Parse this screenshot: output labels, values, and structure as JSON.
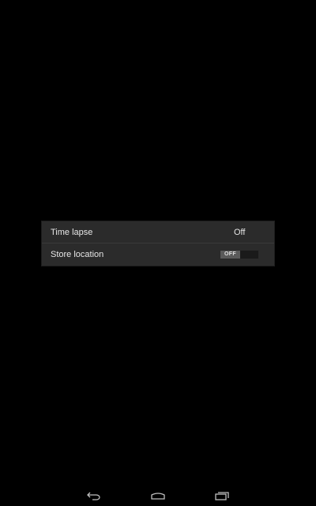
{
  "settings": {
    "rows": [
      {
        "label": "Time lapse",
        "value": "Off"
      },
      {
        "label": "Store location",
        "toggle_text": "OFF",
        "toggle_state": "off"
      }
    ]
  },
  "navigation": {
    "back_icon": "back-icon",
    "home_icon": "home-icon",
    "recents_icon": "recents-icon"
  },
  "colors": {
    "background": "#000000",
    "popup": "#2b2b2b",
    "text": "#e6e6e6"
  }
}
